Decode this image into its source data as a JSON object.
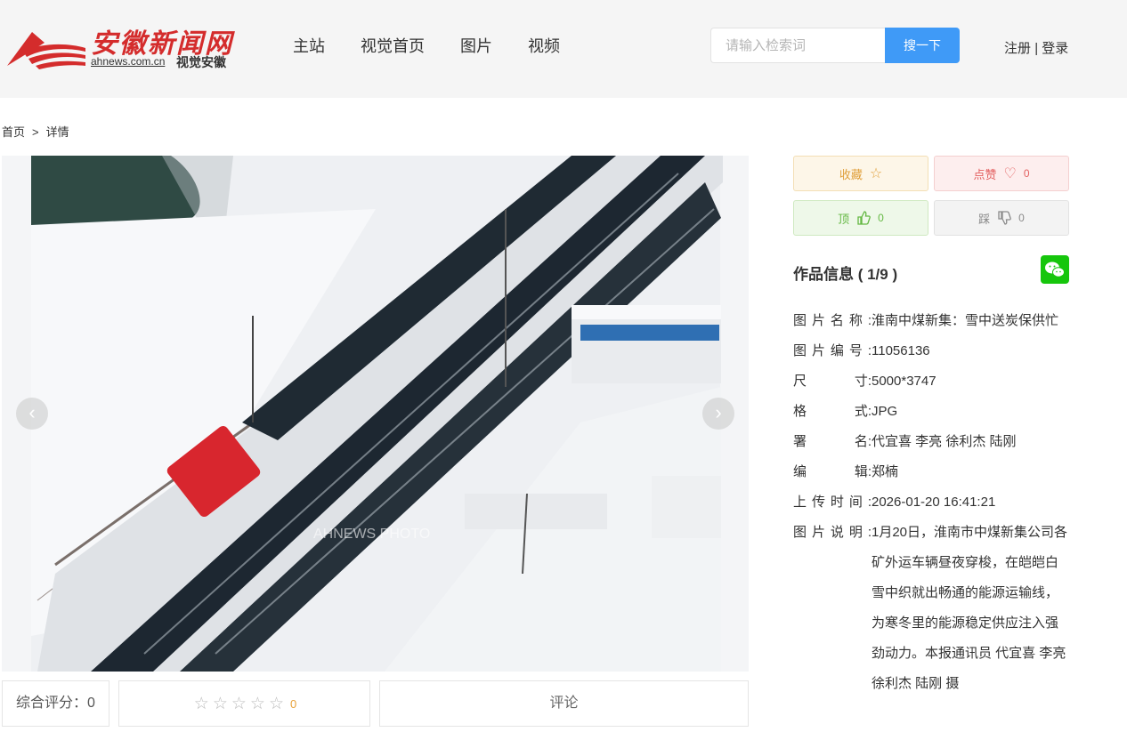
{
  "header": {
    "logo_text": "安徽新闻网",
    "logo_domain": "ahnews.com.cn",
    "logo_sub": "视觉安徽",
    "nav": [
      "主站",
      "视觉首页",
      "图片",
      "视频"
    ],
    "search_placeholder": "请输入检索词",
    "search_button": "搜一下",
    "register": "注册",
    "auth_separator": "|",
    "login": "登录"
  },
  "breadcrumb": {
    "home": "首页",
    "separator": ">",
    "current": "详情"
  },
  "photo": {
    "watermark": "AHNEWS PHOTO"
  },
  "actions": {
    "favorite_label": "收藏",
    "like_label": "点赞",
    "like_count": "0",
    "up_label": "顶",
    "up_count": "0",
    "down_label": "踩",
    "down_count": "0"
  },
  "rating": {
    "label": "综合评分：0",
    "star_score": "0",
    "comment_label": "评论"
  },
  "work_info": {
    "title": "作品信息 ( 1/9 )",
    "fields": [
      {
        "k1": "图片名称:",
        "v": "淮南中煤新集：雪中送炭保供忙"
      },
      {
        "k1": "图片编号:",
        "v": "11056136"
      },
      {
        "k1": "尺",
        "k2": "寸:",
        "v": "5000*3747"
      },
      {
        "k1": "格",
        "k2": "式:",
        "v": "JPG"
      },
      {
        "k1": "署",
        "k2": "名:",
        "v": "代宜喜 李亮 徐利杰 陆刚"
      },
      {
        "k1": "编",
        "k2": "辑:",
        "v": "郑楠"
      },
      {
        "k1": "上传时间:",
        "v": "2026-01-20 16:41:21"
      },
      {
        "k1": "图片说明:",
        "v": "1月20日，淮南市中煤新集公司各矿外运车辆昼夜穿梭，在皑皑白雪中织就出畅通的能源运输线，为寒冬里的能源稳定供应注入强劲动力。本报通讯员 代宜喜 李亮 徐利杰 陆刚 摄"
      }
    ]
  }
}
